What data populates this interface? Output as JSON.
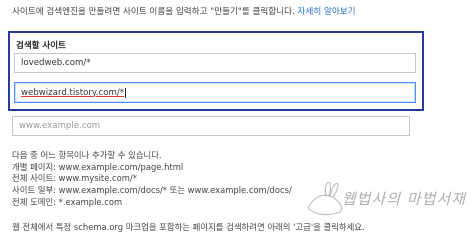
{
  "intro": {
    "text": "사이트에 검색엔진을 만들려면 사이트 이름을 입력하고 \"만들기\"를 클릭합니다.",
    "link": "자세히 알아보기"
  },
  "panel": {
    "title": "검색할 사이트",
    "field1_value": "lovedweb.com/*",
    "field2_value": "webwizard.tistory.com/*"
  },
  "empty_field": {
    "placeholder": "www.example.com"
  },
  "hints": {
    "line1": "다음 중 어느 항목이나 추가할 수 있습니다.",
    "line2": "개별 페이지: www.example.com/page.html",
    "line3": "전체 사이트: www.mysite.com/*",
    "line4": "사이트 일부: www.example.com/docs/* 또는 www.example.com/docs/",
    "line5": "전체 도메인: *.example.com"
  },
  "footer": {
    "text": "웹 전체에서 특정 schema.org 마크업을 포함하는 페이지를 검색하려면 아래의 '고급'을 클릭하세요."
  },
  "watermark": {
    "text": "웹법사의 마법서재"
  },
  "colors": {
    "panel_border": "#2a3a9a",
    "link": "#2a6fcf",
    "focus": "#4d90fe"
  }
}
